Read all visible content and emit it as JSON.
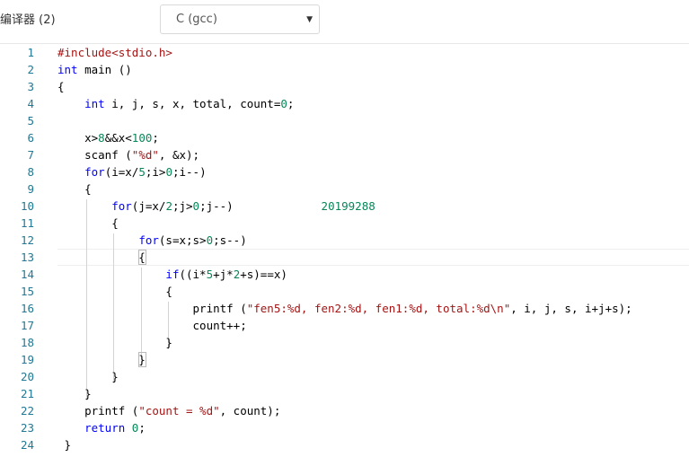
{
  "toolbar": {
    "compiler_label": "编译器 (2)",
    "language_select": {
      "value": "C (gcc)",
      "icon": "caret-down-icon"
    }
  },
  "editor": {
    "current_line": 13,
    "lines": [
      [
        [
          "inc",
          "#include<stdio.h>"
        ]
      ],
      [
        [
          "kw",
          "int"
        ],
        [
          "p",
          " main ()"
        ]
      ],
      [
        [
          "p",
          "{"
        ]
      ],
      [
        [
          "p",
          "    "
        ],
        [
          "kw",
          "int"
        ],
        [
          "p",
          " i, j, s, x, total, count="
        ],
        [
          "num",
          "0"
        ],
        [
          "p",
          ";"
        ]
      ],
      [],
      [
        [
          "p",
          "    x>"
        ],
        [
          "num",
          "8"
        ],
        [
          "p",
          "&&x<"
        ],
        [
          "num",
          "100"
        ],
        [
          "p",
          ";"
        ]
      ],
      [
        [
          "p",
          "    scanf ("
        ],
        [
          "str",
          "\"%d\""
        ],
        [
          "p",
          ", &x);"
        ]
      ],
      [
        [
          "p",
          "    "
        ],
        [
          "kw",
          "for"
        ],
        [
          "p",
          "(i=x/"
        ],
        [
          "num",
          "5"
        ],
        [
          "p",
          ";i>"
        ],
        [
          "num",
          "0"
        ],
        [
          "p",
          ";i--)"
        ]
      ],
      [
        [
          "p",
          "    {"
        ]
      ],
      [
        [
          "p",
          "        "
        ],
        [
          "kw",
          "for"
        ],
        [
          "p",
          "(j=x/"
        ],
        [
          "num",
          "2"
        ],
        [
          "p",
          ";j>"
        ],
        [
          "num",
          "0"
        ],
        [
          "p",
          ";j--)             "
        ],
        [
          "note",
          "20199288"
        ]
      ],
      [
        [
          "p",
          "        {"
        ]
      ],
      [
        [
          "p",
          "            "
        ],
        [
          "kw",
          "for"
        ],
        [
          "p",
          "(s=x;s>"
        ],
        [
          "num",
          "0"
        ],
        [
          "p",
          ";s--)"
        ]
      ],
      [
        [
          "p",
          "            {"
        ]
      ],
      [
        [
          "p",
          "                "
        ],
        [
          "kw",
          "if"
        ],
        [
          "p",
          "((i*"
        ],
        [
          "num",
          "5"
        ],
        [
          "p",
          "+j*"
        ],
        [
          "num",
          "2"
        ],
        [
          "p",
          "+s)==x)"
        ]
      ],
      [
        [
          "p",
          "                {"
        ]
      ],
      [
        [
          "p",
          "                    printf ("
        ],
        [
          "str",
          "\"fen5:%d, fen2:%d, fen1:%d, total:%d\\n\""
        ],
        [
          "p",
          ", i, j, s, i+j+s);"
        ]
      ],
      [
        [
          "p",
          "                    count++;"
        ]
      ],
      [
        [
          "p",
          "                }"
        ]
      ],
      [
        [
          "p",
          "            }"
        ]
      ],
      [
        [
          "p",
          "        }"
        ]
      ],
      [
        [
          "p",
          "    }"
        ]
      ],
      [
        [
          "p",
          "    printf ("
        ],
        [
          "str",
          "\"count = %d\""
        ],
        [
          "p",
          ", count);"
        ]
      ],
      [
        [
          "p",
          "    "
        ],
        [
          "kw",
          "return"
        ],
        [
          "p",
          " "
        ],
        [
          "num",
          "0"
        ],
        [
          "p",
          ";"
        ]
      ],
      [
        [
          "p",
          " }"
        ]
      ]
    ]
  }
}
